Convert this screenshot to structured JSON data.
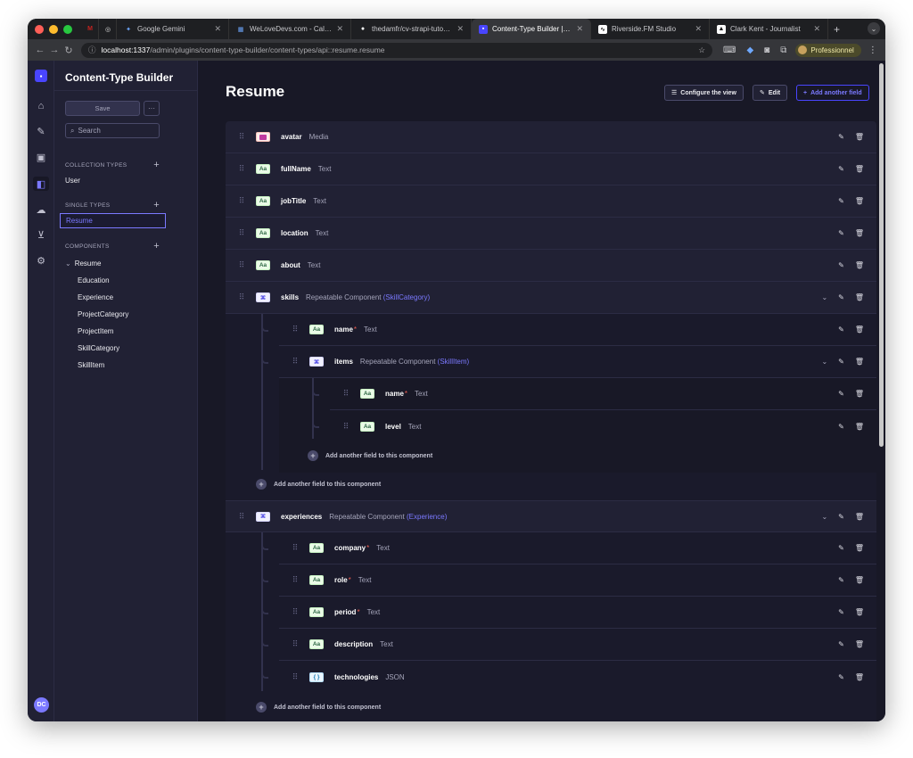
{
  "browser": {
    "tabs": [
      {
        "label": "",
        "fav": "M",
        "fav_color": "#c5221f"
      },
      {
        "label": "",
        "fav": "◎",
        "fav_color": "#3a3a3a"
      },
      {
        "label": "Google Gemini",
        "fav": "✦",
        "fav_color": "#4285f4"
      },
      {
        "label": "WeLoveDevs.com - Calendar",
        "fav": "▦",
        "fav_color": "#3d6fe0"
      },
      {
        "label": "thedamfr/cv-strapi-tutorial at",
        "fav": "●",
        "fav_color": "#ffffff"
      },
      {
        "label": "Content-Type Builder | Strapi",
        "fav": "▪",
        "fav_color": "#4945ff",
        "active": true
      },
      {
        "label": "Riverside.FM Studio",
        "fav": "∿",
        "fav_color": "#222222"
      },
      {
        "label": "Clark Kent - Journalist",
        "fav": "▲",
        "fav_color": "#111111"
      }
    ],
    "url_host": "localhost:1337",
    "url_path": "/admin/plugins/content-type-builder/content-types/api::resume.resume",
    "profile_label": "Professionnel"
  },
  "sidebar": {
    "title": "Content-Type Builder",
    "save_label": "Save",
    "more_label": "···",
    "search_placeholder": "Search",
    "collection_types_label": "COLLECTION TYPES",
    "collection_types": [
      "User"
    ],
    "single_types_label": "SINGLE TYPES",
    "single_types": [
      "Resume"
    ],
    "components_label": "COMPONENTS",
    "component_category": "Resume",
    "components": [
      "Education",
      "Experience",
      "ProjectCategory",
      "ProjectItem",
      "SkillCategory",
      "SkillItem"
    ]
  },
  "user_initials": "DC",
  "header": {
    "title": "Resume",
    "configure_label": "Configure the view",
    "edit_label": "Edit",
    "add_field_label": "Add another field"
  },
  "fields": {
    "avatar": {
      "name": "avatar",
      "type": "Media",
      "badge": ""
    },
    "fullName": {
      "name": "fullName",
      "type": "Text",
      "badge": "Aa"
    },
    "jobTitle": {
      "name": "jobTitle",
      "type": "Text",
      "badge": "Aa"
    },
    "location": {
      "name": "location",
      "type": "Text",
      "badge": "Aa"
    },
    "about": {
      "name": "about",
      "type": "Text",
      "badge": "Aa"
    },
    "skills": {
      "name": "skills",
      "type": "Repeatable Component",
      "component": "(SkillCategory)",
      "badge": "⌘"
    },
    "skills_name": {
      "name": "name",
      "required": "*",
      "type": "Text",
      "badge": "Aa"
    },
    "skills_items": {
      "name": "items",
      "type": "Repeatable Component",
      "component": "(SkillItem)",
      "badge": "⌘"
    },
    "items_name": {
      "name": "name",
      "required": "*",
      "type": "Text",
      "badge": "Aa"
    },
    "items_level": {
      "name": "level",
      "type": "Text",
      "badge": "Aa"
    },
    "experiences": {
      "name": "experiences",
      "type": "Repeatable Component",
      "component": "(Experience)",
      "badge": "⌘"
    },
    "exp_company": {
      "name": "company",
      "required": "*",
      "type": "Text",
      "badge": "Aa"
    },
    "exp_role": {
      "name": "role",
      "required": "*",
      "type": "Text",
      "badge": "Aa"
    },
    "exp_period": {
      "name": "period",
      "required": "*",
      "type": "Text",
      "badge": "Aa"
    },
    "exp_description": {
      "name": "description",
      "type": "Text",
      "badge": "Aa"
    },
    "exp_technologies": {
      "name": "technologies",
      "type": "JSON",
      "badge": "{ }"
    }
  },
  "add_to_component_label": "Add another field to this component"
}
